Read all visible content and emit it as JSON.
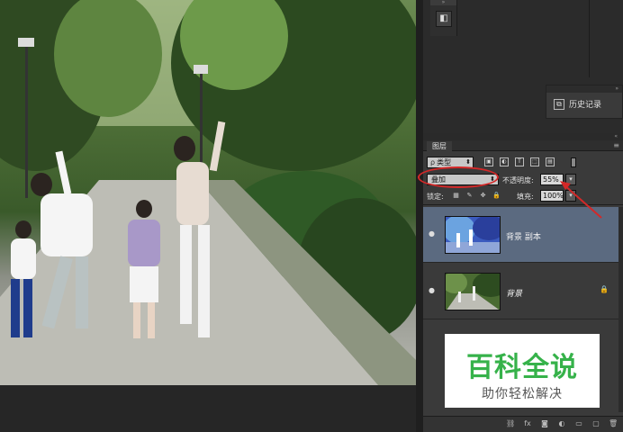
{
  "mini_panel": {
    "button_icon": "layer-comps-icon"
  },
  "history_panel": {
    "label": "历史记录",
    "icon": "history-icon"
  },
  "layers_panel": {
    "tab_label": "图层",
    "filter": {
      "kind_prefix": "ρ",
      "kind_label": "类型"
    },
    "blend_mode": "叠加",
    "opacity_label": "不透明度:",
    "opacity_value": "55%",
    "lock_label": "锁定:",
    "fill_label": "填充:",
    "fill_value": "100%",
    "layers": [
      {
        "name": "背景 副本",
        "selected": true,
        "visible": true
      },
      {
        "name": "背景",
        "selected": false,
        "visible": true,
        "locked": true
      }
    ]
  },
  "watermark": {
    "title": "百科全说",
    "subtitle": "助你轻松解决"
  },
  "colors": {
    "annotation": "#d42828",
    "selected_layer": "#5b6a80",
    "watermark_green": "#36b24a"
  }
}
